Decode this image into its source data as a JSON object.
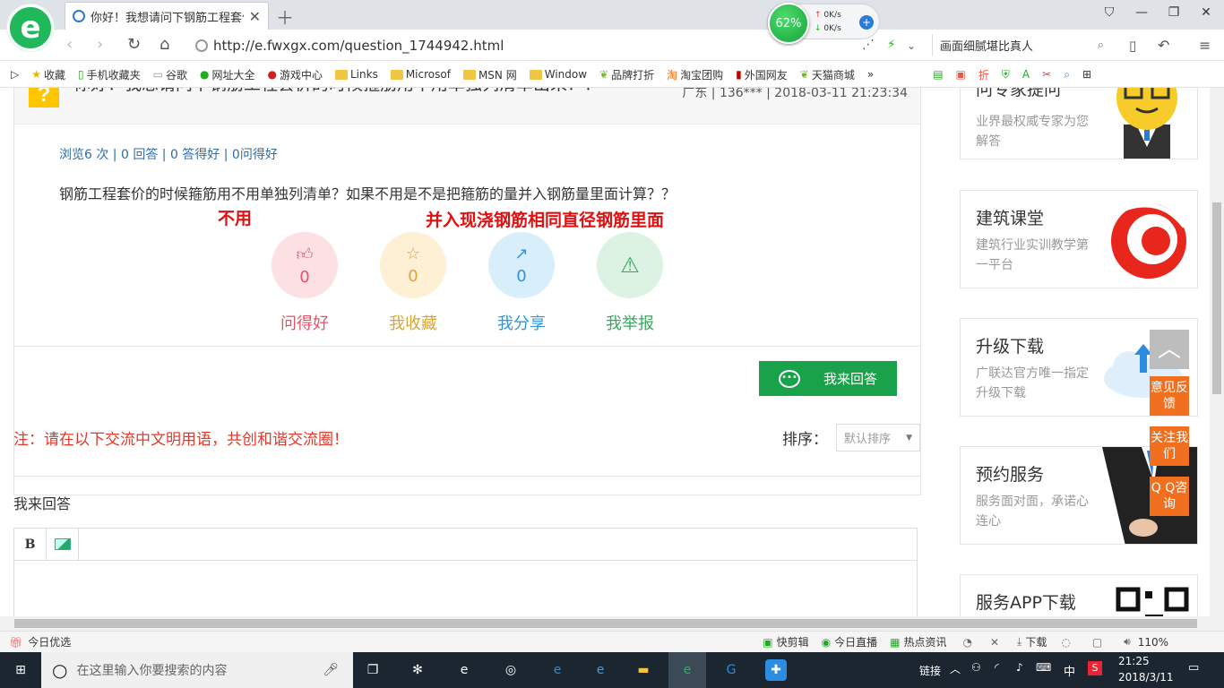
{
  "browser": {
    "tab_title": "你好！我想请问下钢筋工程套价的",
    "url": "http://e.fwxgx.com/question_1744942.html",
    "search_text": "画面细腻堪比真人",
    "widget": {
      "percent": "62%",
      "up": "0K/s",
      "down": "0K/s"
    }
  },
  "bookmarks": [
    "收藏",
    "手机收藏夹",
    "谷歌",
    "网址大全",
    "游戏中心",
    "Links",
    "Microsof",
    "MSN 网",
    "Window",
    "品牌打折",
    "淘宝团购",
    "外国网友",
    "天猫商城"
  ],
  "question": {
    "title": "你好！我想请问下钢筋工程套价的时候箍筋用不用单独列清单出来？？",
    "meta": "广东 | 136*** | 2018-03-11 21:23:34",
    "stats": "浏览6 次 | 0 回答 | 0 答得好 | 0问得好",
    "text": "钢筋工程套价的时候箍筋用不用单独列清单？如果不用是不是把箍筋的量并入钢筋量里面计算？？",
    "annotation_left": "不用",
    "annotation_right": "并入现浇钢筋相同直径钢筋里面",
    "actions": [
      {
        "label": "问得好",
        "count": "0",
        "color": "#e0556a",
        "bg": "#fde0e4"
      },
      {
        "label": "我收藏",
        "count": "0",
        "color": "#d9a53a",
        "bg": "#fdf0d4"
      },
      {
        "label": "我分享",
        "count": "0",
        "color": "#2f95d8",
        "bg": "#d9eefb"
      },
      {
        "label": "我举报",
        "count": "",
        "color": "#3aa760",
        "bg": "#dcf3e4"
      }
    ],
    "answer_button": "我来回答"
  },
  "notice": "注：请在以下交流中文明用语，共创和谐交流圈！",
  "sort": {
    "label": "排序：",
    "value": "默认排序"
  },
  "reply_heading": "我来回答",
  "sidebar": [
    {
      "title": "问专家提问",
      "desc": "业界最权威专家为您解答"
    },
    {
      "title": "建筑课堂",
      "desc": "建筑行业实训教学第一平台"
    },
    {
      "title": "升级下载",
      "desc": "广联达官方唯一指定升级下载"
    },
    {
      "title": "预约服务",
      "desc": "服务面对面，承诺心连心"
    },
    {
      "title": "服务APP下载",
      "desc": ""
    }
  ],
  "float_buttons": [
    "意见反馈",
    "关注我们",
    "Q Q咨询"
  ],
  "statusbar": {
    "left": "今日优选",
    "items": [
      "快剪辑",
      "今日直播",
      "热点资讯",
      "下载"
    ],
    "zoom": "110%"
  },
  "taskbar": {
    "search_placeholder": "在这里输入你要搜索的内容",
    "tray_link": "链接",
    "ime": "中",
    "time": "21:25",
    "date": "2018/3/11"
  },
  "colors": {
    "accent_green": "#19a24a",
    "annotation_red": "#e01010",
    "float_orange": "#f07020"
  }
}
